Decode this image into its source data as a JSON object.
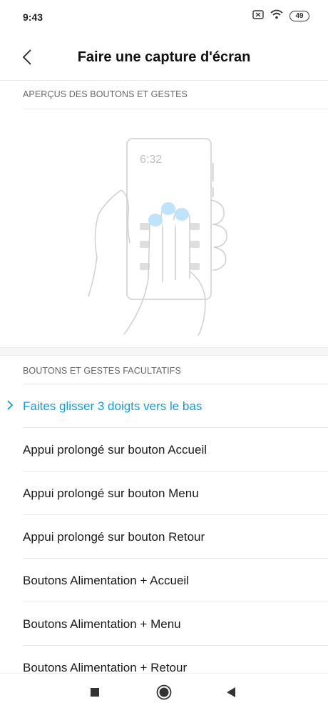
{
  "status": {
    "time": "9:43",
    "battery": "49",
    "icons": [
      "sim-off-icon",
      "wifi-icon",
      "battery-icon"
    ]
  },
  "header": {
    "title": "Faire une capture d'écran",
    "back_icon": "back-chevron-icon"
  },
  "preview_section": {
    "title": "APERÇUS DES BOUTONS ET GESTES",
    "illustration_time": "6:32"
  },
  "options_section": {
    "title": "BOUTONS ET GESTES FACULTATIFS",
    "items": [
      {
        "label": "Faites glisser 3 doigts vers le bas",
        "selected": true
      },
      {
        "label": "Appui prolongé sur bouton Accueil",
        "selected": false
      },
      {
        "label": "Appui prolongé sur bouton Menu",
        "selected": false
      },
      {
        "label": "Appui prolongé sur bouton Retour",
        "selected": false
      },
      {
        "label": "Boutons Alimentation + Accueil",
        "selected": false
      },
      {
        "label": "Boutons Alimentation + Menu",
        "selected": false
      },
      {
        "label": "Boutons Alimentation + Retour",
        "selected": false
      }
    ]
  },
  "nav": {
    "buttons": [
      "recents-icon",
      "home-icon",
      "back-icon"
    ]
  },
  "colors": {
    "accent": "#0d9de6",
    "text": "#1a1a1a",
    "secondary_text": "#666666",
    "divider": "#e8e8e8"
  }
}
